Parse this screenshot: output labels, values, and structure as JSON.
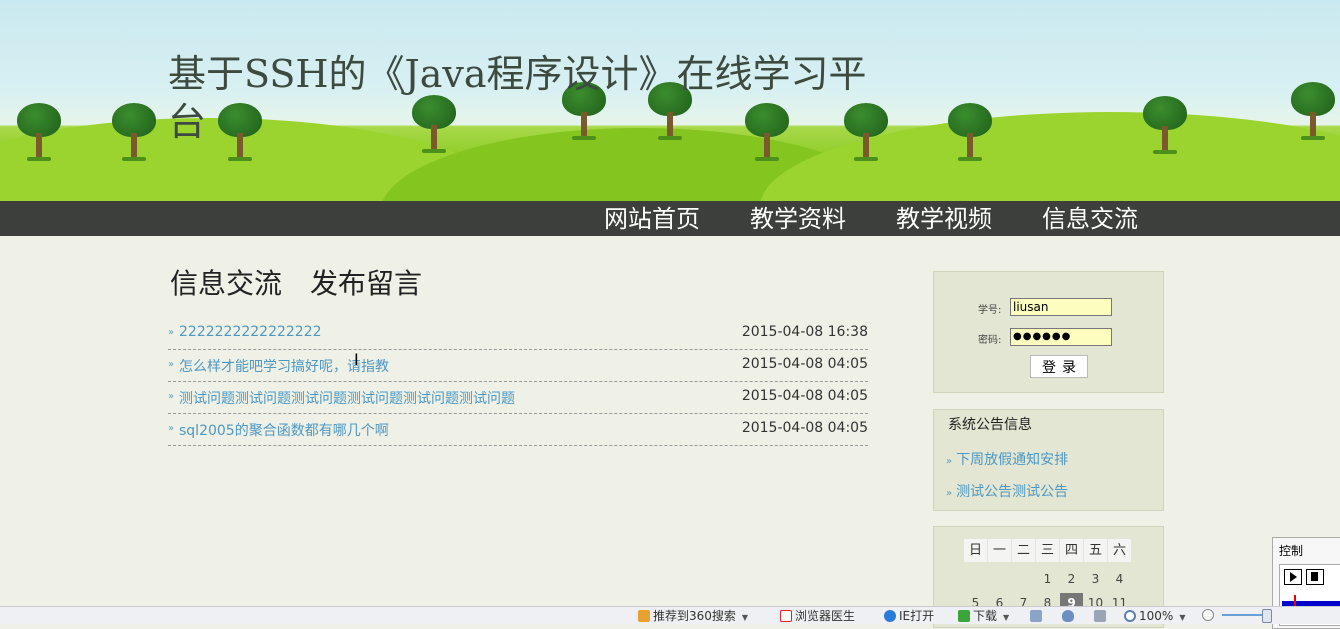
{
  "site": {
    "title": "基于SSH的《Java程序设计》在线学习平台"
  },
  "nav": {
    "items": [
      "网站首页",
      "教学资料",
      "教学视频",
      "信息交流"
    ]
  },
  "main": {
    "section_title": "信息交流",
    "post_link": "发布留言",
    "messages": [
      {
        "title": "2222222222222222",
        "date": "2015-04-08 16:38"
      },
      {
        "title": "怎么样才能吧学习搞好呢，请指教",
        "date": "2015-04-08 04:05"
      },
      {
        "title": "测试问题测试问题测试问题测试问题测试问题测试问题",
        "date": "2015-04-08 04:05"
      },
      {
        "title": "sql2005的聚合函数都有哪几个啊",
        "date": "2015-04-08 04:05"
      }
    ]
  },
  "login": {
    "student_id_label": "学号:",
    "student_id_value": "liusan",
    "password_label": "密码:",
    "password_mask": "●●●●●●",
    "login_button": "登录"
  },
  "notices": {
    "title": "系统公告信息",
    "items": [
      "下周放假通知安排",
      "测试公告测试公告"
    ]
  },
  "calendar": {
    "weekdays": [
      "日",
      "一",
      "二",
      "三",
      "四",
      "五",
      "六"
    ],
    "row1": [
      "1",
      "2",
      "3",
      "4"
    ],
    "row2": [
      "5",
      "6",
      "7",
      "8",
      "9",
      "10",
      "11"
    ],
    "today": "9"
  },
  "control_panel": {
    "title": "控制"
  },
  "statusbar": {
    "recommend": "推荐到360搜索",
    "doctor": "浏览器医生",
    "ie_open": "IE打开",
    "download": "下载",
    "zoom": "100%"
  },
  "colors": {
    "link": "#4e98c5",
    "nav_bg": "#3c3f3b",
    "page_bg": "#eff1e6",
    "sidebar_bg": "#e2e6d2"
  }
}
